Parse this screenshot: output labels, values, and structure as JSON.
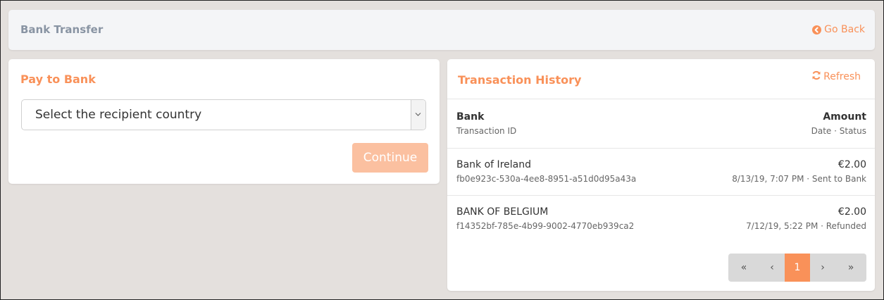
{
  "header": {
    "title": "Bank Transfer",
    "go_back_label": "Go Back"
  },
  "pay_to_bank": {
    "title": "Pay to Bank",
    "select_value": "Select the recipient country",
    "continue_label": "Continue"
  },
  "history": {
    "title": "Transaction History",
    "refresh_label": "Refresh",
    "columns": {
      "bank": "Bank",
      "transaction_id": "Transaction ID",
      "amount": "Amount",
      "date_status": "Date · Status"
    },
    "rows": [
      {
        "bank": "Bank of Ireland",
        "transaction_id": "fb0e923c-530a-4ee8-8951-a51d0d95a43a",
        "amount": "€2.00",
        "date_status": "8/13/19, 7:07 PM · Sent to Bank"
      },
      {
        "bank": "BANK OF BELGIUM",
        "transaction_id": "f14352bf-785e-4b99-9002-4770eb939ca2",
        "amount": "€2.00",
        "date_status": "7/12/19, 5:22 PM · Refunded"
      }
    ],
    "pagination": {
      "first": "«",
      "prev": "‹",
      "current": "1",
      "next": "›",
      "last": "»"
    }
  },
  "colors": {
    "accent": "#f99159",
    "accent_disabled": "#fbc0a0",
    "background": "#e4e0dd",
    "header_text": "#8994a3"
  },
  "icons": {
    "go_back": "chevron-circle-left-icon",
    "refresh": "refresh-icon",
    "select_caret": "chevron-down-icon"
  }
}
